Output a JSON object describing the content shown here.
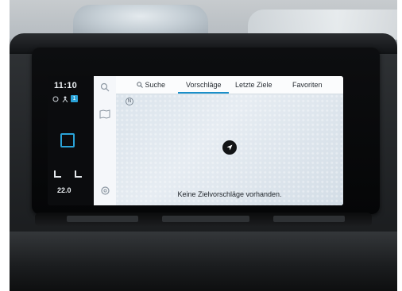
{
  "status": {
    "time": "11:10",
    "temperature": "22.0",
    "accent_color": "#2aa3d8"
  },
  "tabs": [
    {
      "label": "Suche",
      "icon": "search-icon",
      "active": false
    },
    {
      "label": "Vorschläge",
      "active": true
    },
    {
      "label": "Letzte Ziele",
      "active": false
    },
    {
      "label": "Favoriten",
      "active": false
    }
  ],
  "map": {
    "compass": "N",
    "message": "Keine Zielvorschläge vorhanden."
  },
  "sidebar_icons": [
    "search-icon",
    "map-icon",
    "settings-icon"
  ]
}
